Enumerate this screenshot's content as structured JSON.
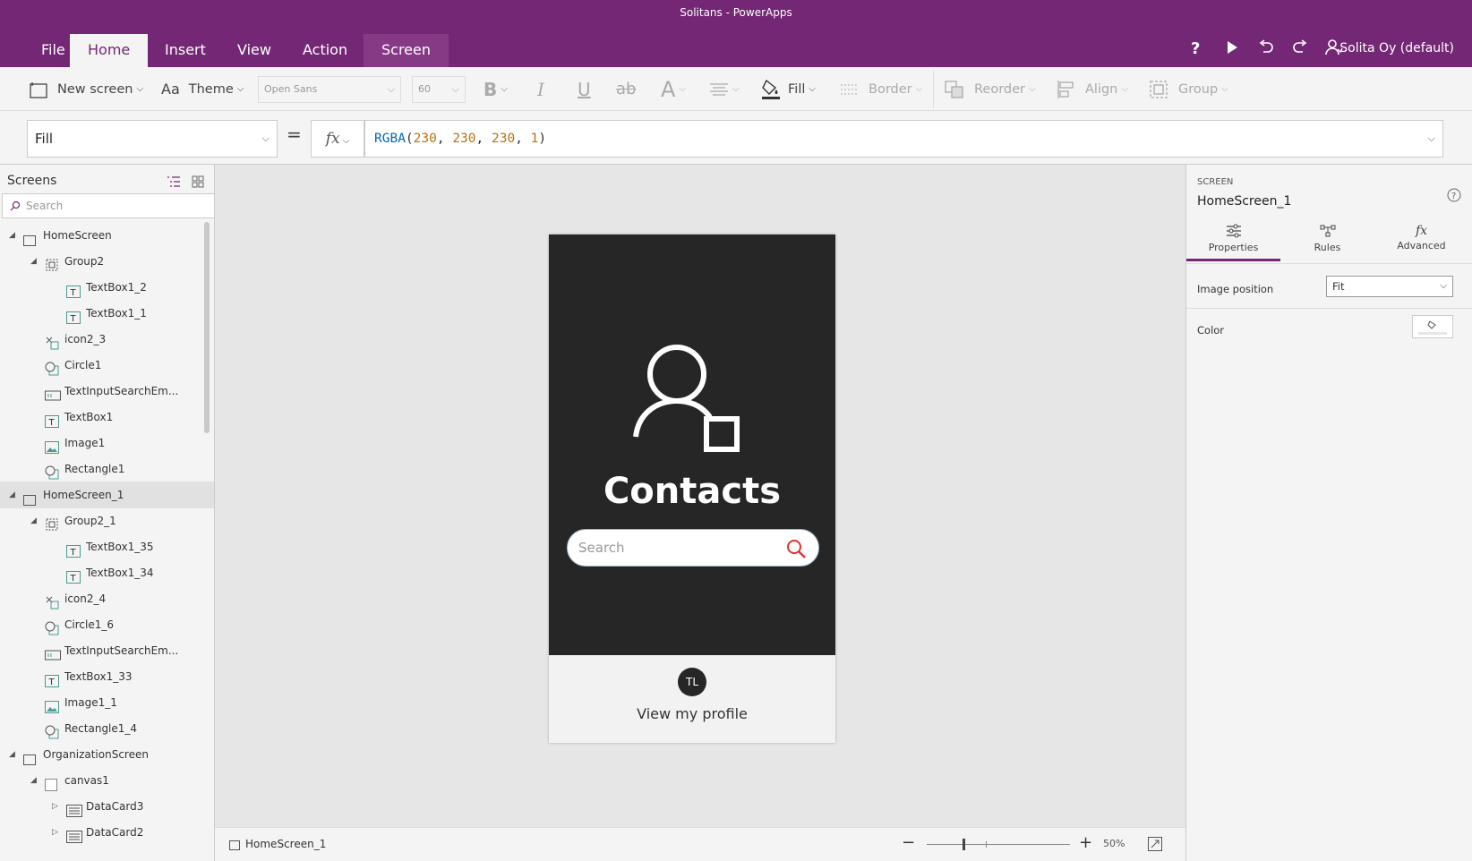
{
  "window": {
    "title": "Solitans - PowerApps"
  },
  "menu": {
    "tabs": [
      "File",
      "Home",
      "Insert",
      "View",
      "Action",
      "Screen"
    ],
    "user": "Solita Oy (default)"
  },
  "ribbon": {
    "new_screen": "New screen",
    "theme": "Theme",
    "font": "Open Sans",
    "font_size": "60",
    "bold": "B",
    "italic": "I",
    "underline": "U",
    "strike": "ab",
    "fontcolor": "A",
    "fill": "Fill",
    "border": "Border",
    "reorder": "Reorder",
    "align": "Align",
    "group": "Group"
  },
  "formula_bar": {
    "property": "Fill",
    "equals": "=",
    "fx": "fx",
    "fn": "RGBA",
    "args": [
      "230",
      "230",
      "230",
      "1"
    ]
  },
  "sidebar": {
    "title": "Screens",
    "search_placeholder": "Search",
    "items": [
      {
        "label": "HomeScreen",
        "level": 0,
        "type": "screen",
        "arrow": "down"
      },
      {
        "label": "Group2",
        "level": 1,
        "type": "group",
        "arrow": "down"
      },
      {
        "label": "TextBox1_2",
        "level": 2,
        "type": "text"
      },
      {
        "label": "TextBox1_1",
        "level": 2,
        "type": "text"
      },
      {
        "label": "icon2_3",
        "level": 1,
        "type": "icon"
      },
      {
        "label": "Circle1",
        "level": 1,
        "type": "shape"
      },
      {
        "label": "TextInputSearchEm...",
        "level": 1,
        "type": "input"
      },
      {
        "label": "TextBox1",
        "level": 1,
        "type": "text"
      },
      {
        "label": "Image1",
        "level": 1,
        "type": "image"
      },
      {
        "label": "Rectangle1",
        "level": 1,
        "type": "shape"
      },
      {
        "label": "HomeScreen_1",
        "level": 0,
        "type": "screen",
        "arrow": "down",
        "selected": true
      },
      {
        "label": "Group2_1",
        "level": 1,
        "type": "group",
        "arrow": "down"
      },
      {
        "label": "TextBox1_35",
        "level": 2,
        "type": "text"
      },
      {
        "label": "TextBox1_34",
        "level": 2,
        "type": "text"
      },
      {
        "label": "icon2_4",
        "level": 1,
        "type": "icon"
      },
      {
        "label": "Circle1_6",
        "level": 1,
        "type": "shape"
      },
      {
        "label": "TextInputSearchEm...",
        "level": 1,
        "type": "input"
      },
      {
        "label": "TextBox1_33",
        "level": 1,
        "type": "text"
      },
      {
        "label": "Image1_1",
        "level": 1,
        "type": "image"
      },
      {
        "label": "Rectangle1_4",
        "level": 1,
        "type": "shape"
      },
      {
        "label": "OrganizationScreen",
        "level": 0,
        "type": "screen",
        "arrow": "down"
      },
      {
        "label": "canvas1",
        "level": 1,
        "type": "canvas",
        "arrow": "down"
      },
      {
        "label": "DataCard3",
        "level": 2,
        "type": "card",
        "arrow": "right"
      },
      {
        "label": "DataCard2",
        "level": 2,
        "type": "card",
        "arrow": "right"
      }
    ]
  },
  "canvas": {
    "app_title": "Contacts",
    "search_placeholder": "Search",
    "avatar_initials": "TL",
    "profile_link": "View my profile",
    "status_screen": "HomeScreen_1",
    "zoom": "50%",
    "zoom_minus": "−",
    "zoom_plus": "+"
  },
  "right_panel": {
    "section": "SCREEN",
    "screen_name": "HomeScreen_1",
    "tabs": [
      "Properties",
      "Rules",
      "Advanced"
    ],
    "image_position_label": "Image position",
    "image_position_value": "Fit",
    "color_label": "Color"
  },
  "colors": {
    "brand": "#742774",
    "canvas_dark": "#262626",
    "accent_red": "#e0342e"
  }
}
